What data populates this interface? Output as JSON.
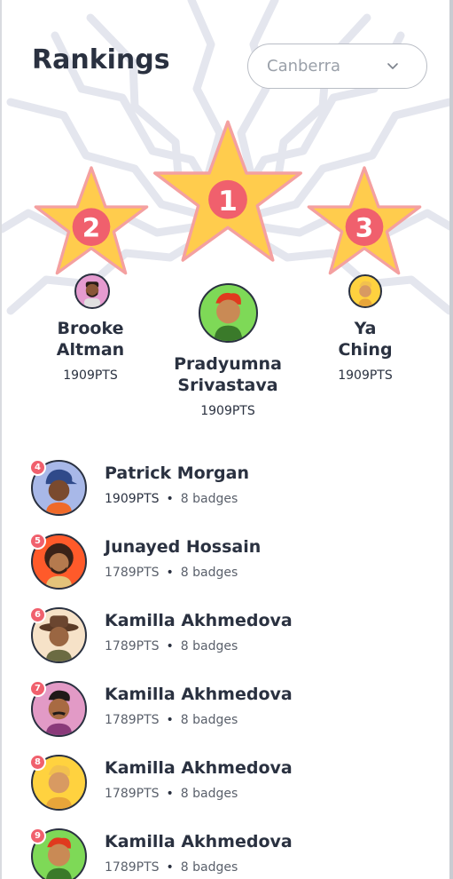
{
  "header": {
    "title": "Rankings",
    "city_select": {
      "value": "Canberra"
    }
  },
  "podium": [
    {
      "rank": "1",
      "name": "Pradyumna\nSrivastava",
      "points": "1909PTS",
      "avatar": "avatar-boy-red-hair",
      "bg": "#7ed957"
    },
    {
      "rank": "2",
      "name": "Brooke\nAltman",
      "points": "1909PTS",
      "avatar": "avatar-man-beard",
      "bg": "#e59bd0"
    },
    {
      "rank": "3",
      "name": "Ya\nChing",
      "points": "1909PTS",
      "avatar": "avatar-boy-blond",
      "bg": "#ffd23f"
    }
  ],
  "list": [
    {
      "rank": "4",
      "name": "Patrick Morgan",
      "points": "1909PTS",
      "badges": "8 badges",
      "bg": "#a8b8e8"
    },
    {
      "rank": "5",
      "name": "Junayed Hossain",
      "points": "1789PTS",
      "badges": "8 badges",
      "bg": "#ff5a2a"
    },
    {
      "rank": "6",
      "name": "Kamilla Akhmedova",
      "points": "1789PTS",
      "badges": "8 badges",
      "bg": "#f6e2c8"
    },
    {
      "rank": "7",
      "name": "Kamilla Akhmedova",
      "points": "1789PTS",
      "badges": "8 badges",
      "bg": "#e29ac6"
    },
    {
      "rank": "8",
      "name": "Kamilla Akhmedova",
      "points": "1789PTS",
      "badges": "8 badges",
      "bg": "#ffd23f"
    },
    {
      "rank": "9",
      "name": "Kamilla Akhmedova",
      "points": "1789PTS",
      "badges": "8 badges",
      "bg": "#7ed957"
    }
  ],
  "colors": {
    "star": "#ffcc4d",
    "star_edge": "#f4a0a0",
    "rank_circle": "#f0606d",
    "text": "#2a3140"
  }
}
